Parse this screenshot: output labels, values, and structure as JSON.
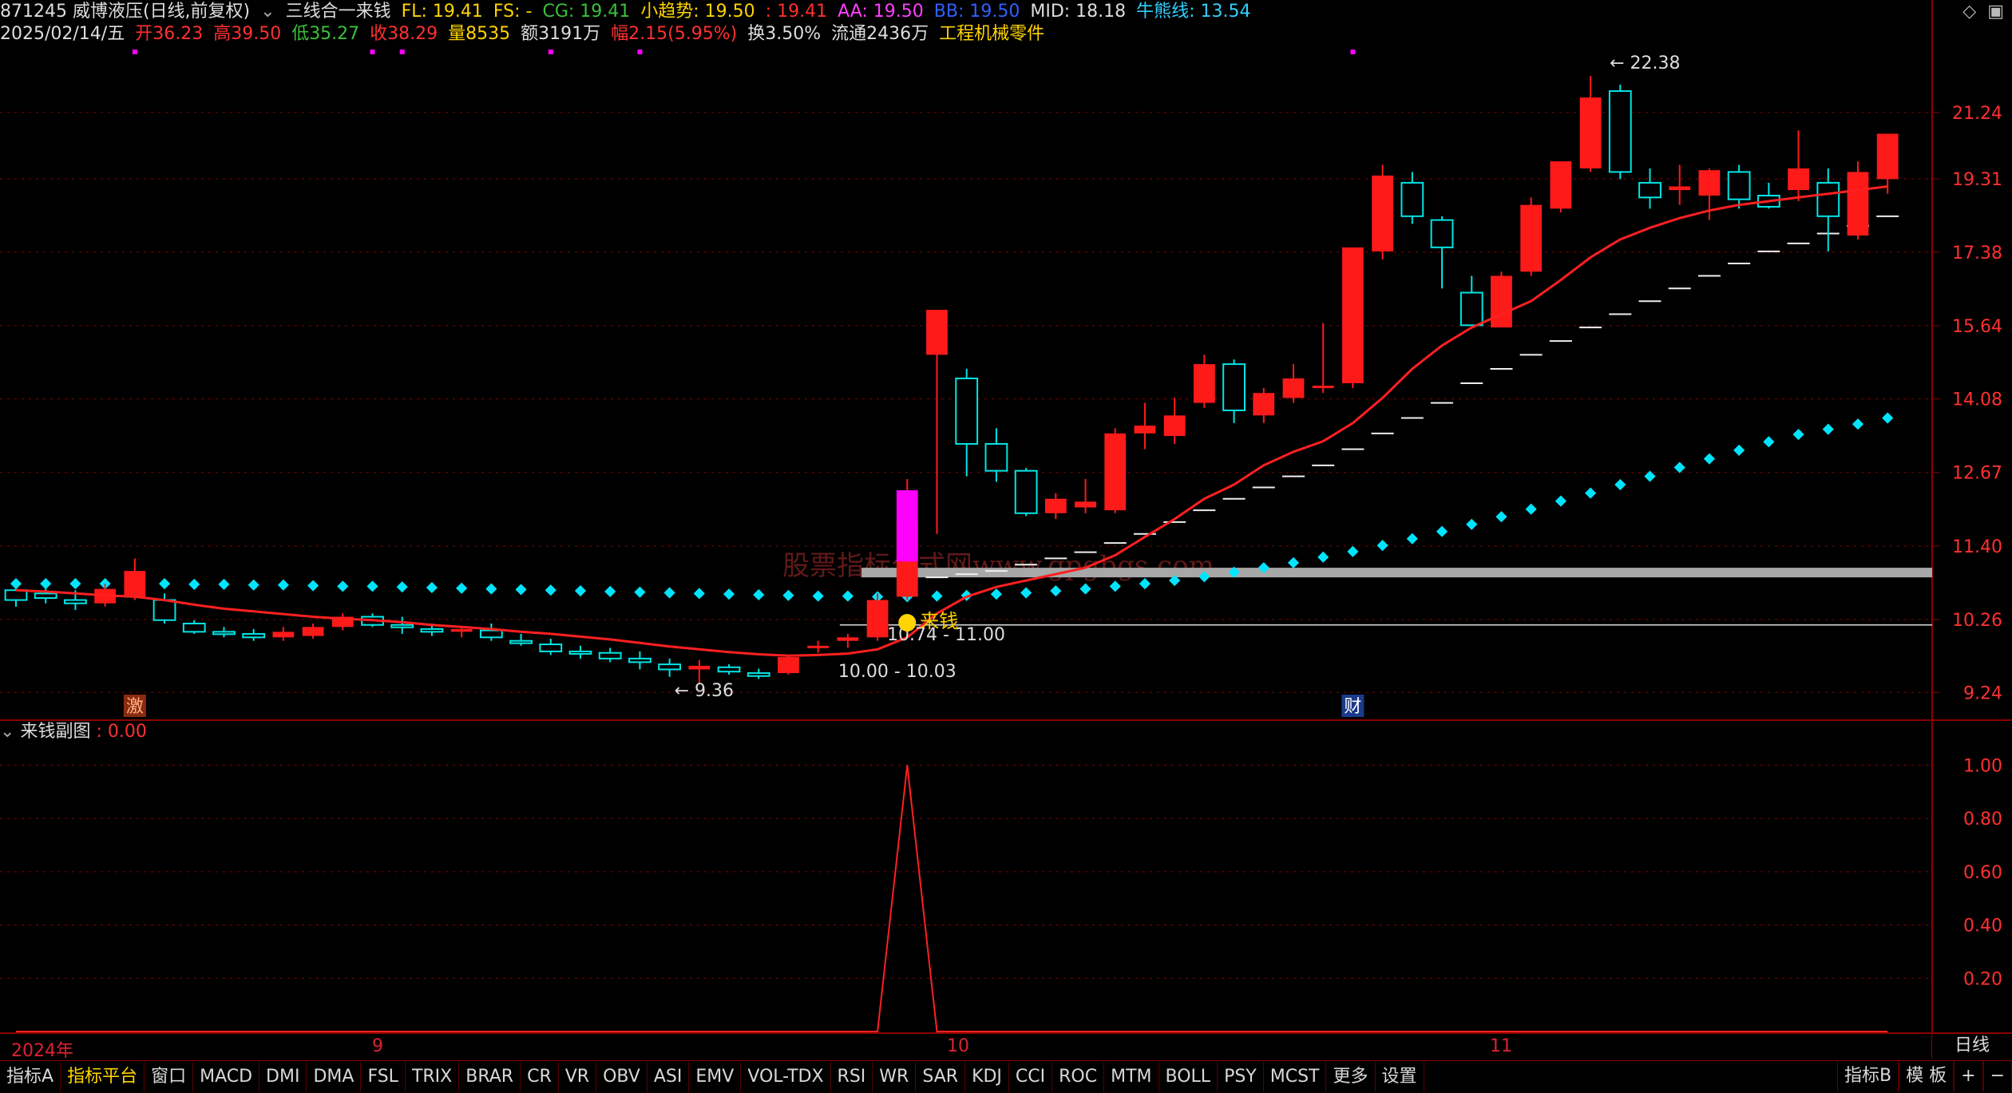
{
  "header": {
    "code_name": "871245 威博液压(日线,前复权)",
    "indicator_name": "三线合一来钱",
    "fl": "FL: 19.41",
    "fs": "FS: -",
    "cg": "CG: 19.41",
    "xqs": "小趋势: 19.50",
    "dash_val": ": 19.41",
    "aa": "AA: 19.50",
    "bb": "BB: 19.50",
    "mid": "MID: 18.18",
    "nxx": "牛熊线: 13.54",
    "date": "2025/02/14/五",
    "open": "开36.23",
    "high": "高39.50",
    "low": "低35.27",
    "close": "收38.29",
    "vol": "量8535",
    "amount": "额3191万",
    "change": "幅2.15(5.95%)",
    "turnover": "换3.50%",
    "float": "流通2436万",
    "industry": "工程机械零件"
  },
  "topright_icons": [
    "diamond-icon",
    "window-icon"
  ],
  "colors": {
    "up": "#ff1a1a",
    "down": "#00e5e5",
    "ma": "#ff2020",
    "dots": "#00e5ff",
    "grid": "#8b0000",
    "magenta": "#ff00ff",
    "gray_band": "#a8a8a8"
  },
  "main_axis": {
    "ticks": [
      "21.24",
      "19.31",
      "17.38",
      "15.64",
      "14.08",
      "12.67",
      "11.40",
      "10.26",
      "9.24"
    ]
  },
  "annotations": {
    "high_label": "22.38",
    "low_label": "9.36",
    "range1": "10.00 - 10.03",
    "range2": "10.74 - 11.00",
    "signal_label": "来钱",
    "signal_icon": "coin-icon",
    "mark_ji": "激",
    "mark_cai": "财",
    "watermark": "股票指标公式网www.gpgbgs.com"
  },
  "subchart": {
    "title": "来钱副图",
    "value": ": 0.00",
    "ticks": [
      "1.00",
      "0.80",
      "0.60",
      "0.40",
      "0.20"
    ]
  },
  "date_axis": {
    "labels": [
      "2024年",
      "9",
      "10",
      "11"
    ],
    "period_button": "日线"
  },
  "toolbar": {
    "tabs": [
      "指标A",
      "指标平台",
      "窗口",
      "MACD",
      "DMI",
      "DMA",
      "FSL",
      "TRIX",
      "BRAR",
      "CR",
      "VR",
      "OBV",
      "ASI",
      "EMV",
      "VOL-TDX",
      "RSI",
      "WR",
      "SAR",
      "KDJ",
      "CCI",
      "ROC",
      "MTM",
      "BOLL",
      "PSY",
      "MCST",
      "更多",
      "设置"
    ],
    "active_index": 1,
    "right": [
      "指标B",
      "模 板",
      "+",
      "−"
    ]
  },
  "chart_data": {
    "type": "candlestick",
    "y_scale": "log",
    "ylim": [
      8.9,
      23.3
    ],
    "candles": [
      {
        "o": 10.7,
        "h": 10.85,
        "l": 10.45,
        "c": 10.55
      },
      {
        "o": 10.65,
        "h": 10.8,
        "l": 10.5,
        "c": 10.58
      },
      {
        "o": 10.55,
        "h": 10.7,
        "l": 10.4,
        "c": 10.5
      },
      {
        "o": 10.5,
        "h": 10.8,
        "l": 10.45,
        "c": 10.72
      },
      {
        "o": 10.6,
        "h": 11.2,
        "l": 10.55,
        "c": 11.0
      },
      {
        "o": 10.55,
        "h": 10.65,
        "l": 10.2,
        "c": 10.25
      },
      {
        "o": 10.2,
        "h": 10.25,
        "l": 10.05,
        "c": 10.08
      },
      {
        "o": 10.08,
        "h": 10.15,
        "l": 10.0,
        "c": 10.05
      },
      {
        "o": 10.05,
        "h": 10.12,
        "l": 9.95,
        "c": 10.0
      },
      {
        "o": 10.0,
        "h": 10.15,
        "l": 9.95,
        "c": 10.08
      },
      {
        "o": 10.02,
        "h": 10.2,
        "l": 9.98,
        "c": 10.15
      },
      {
        "o": 10.15,
        "h": 10.35,
        "l": 10.1,
        "c": 10.3
      },
      {
        "o": 10.3,
        "h": 10.35,
        "l": 10.15,
        "c": 10.18
      },
      {
        "o": 10.18,
        "h": 10.3,
        "l": 10.05,
        "c": 10.15
      },
      {
        "o": 10.12,
        "h": 10.2,
        "l": 10.02,
        "c": 10.08
      },
      {
        "o": 10.08,
        "h": 10.15,
        "l": 10.0,
        "c": 10.12
      },
      {
        "o": 10.1,
        "h": 10.2,
        "l": 9.95,
        "c": 10.0
      },
      {
        "o": 9.95,
        "h": 10.05,
        "l": 9.88,
        "c": 9.92
      },
      {
        "o": 9.9,
        "h": 9.98,
        "l": 9.75,
        "c": 9.8
      },
      {
        "o": 9.8,
        "h": 9.88,
        "l": 9.7,
        "c": 9.78
      },
      {
        "o": 9.78,
        "h": 9.85,
        "l": 9.65,
        "c": 9.7
      },
      {
        "o": 9.7,
        "h": 9.8,
        "l": 9.55,
        "c": 9.65
      },
      {
        "o": 9.62,
        "h": 9.7,
        "l": 9.45,
        "c": 9.55
      },
      {
        "o": 9.55,
        "h": 9.68,
        "l": 9.36,
        "c": 9.6
      },
      {
        "o": 9.58,
        "h": 9.62,
        "l": 9.48,
        "c": 9.52
      },
      {
        "o": 9.5,
        "h": 9.56,
        "l": 9.42,
        "c": 9.46
      },
      {
        "o": 9.5,
        "h": 9.75,
        "l": 9.48,
        "c": 9.72
      },
      {
        "o": 9.85,
        "h": 9.95,
        "l": 9.78,
        "c": 9.88
      },
      {
        "o": 9.95,
        "h": 10.05,
        "l": 9.85,
        "c": 10.0
      },
      {
        "o": 10.0,
        "h": 10.65,
        "l": 9.95,
        "c": 10.55
      },
      {
        "o": 10.6,
        "h": 12.55,
        "l": 10.55,
        "c": 11.8
      },
      {
        "o": 15.0,
        "h": 15.1,
        "l": 11.6,
        "c": 16.0
      },
      {
        "o": 14.5,
        "h": 14.7,
        "l": 12.6,
        "c": 13.2
      },
      {
        "o": 13.2,
        "h": 13.5,
        "l": 12.5,
        "c": 12.7
      },
      {
        "o": 12.7,
        "h": 12.75,
        "l": 11.9,
        "c": 11.95
      },
      {
        "o": 11.95,
        "h": 12.3,
        "l": 11.85,
        "c": 12.2
      },
      {
        "o": 12.05,
        "h": 12.55,
        "l": 11.95,
        "c": 12.15
      },
      {
        "o": 12.0,
        "h": 13.5,
        "l": 11.95,
        "c": 13.4
      },
      {
        "o": 13.4,
        "h": 14.0,
        "l": 13.1,
        "c": 13.55
      },
      {
        "o": 13.35,
        "h": 14.1,
        "l": 13.2,
        "c": 13.75
      },
      {
        "o": 14.0,
        "h": 15.0,
        "l": 13.9,
        "c": 14.8
      },
      {
        "o": 14.8,
        "h": 14.9,
        "l": 13.6,
        "c": 13.85
      },
      {
        "o": 13.75,
        "h": 14.3,
        "l": 13.6,
        "c": 14.2
      },
      {
        "o": 14.1,
        "h": 14.8,
        "l": 14.0,
        "c": 14.5
      },
      {
        "o": 14.3,
        "h": 15.7,
        "l": 14.2,
        "c": 14.35
      },
      {
        "o": 14.4,
        "h": 17.3,
        "l": 14.3,
        "c": 17.5
      },
      {
        "o": 17.4,
        "h": 19.7,
        "l": 17.2,
        "c": 19.4
      },
      {
        "o": 19.2,
        "h": 19.5,
        "l": 18.1,
        "c": 18.3
      },
      {
        "o": 18.2,
        "h": 18.3,
        "l": 16.5,
        "c": 17.5
      },
      {
        "o": 16.4,
        "h": 16.8,
        "l": 16.2,
        "c": 15.65
      },
      {
        "o": 15.6,
        "h": 16.9,
        "l": 15.6,
        "c": 16.8
      },
      {
        "o": 16.9,
        "h": 18.8,
        "l": 16.8,
        "c": 18.6
      },
      {
        "o": 18.5,
        "h": 19.8,
        "l": 18.4,
        "c": 19.8
      },
      {
        "o": 19.6,
        "h": 22.38,
        "l": 19.5,
        "c": 21.7
      },
      {
        "o": 21.9,
        "h": 22.1,
        "l": 19.3,
        "c": 19.5
      },
      {
        "o": 19.2,
        "h": 19.6,
        "l": 18.5,
        "c": 18.8
      },
      {
        "o": 19.0,
        "h": 19.7,
        "l": 18.6,
        "c": 19.1
      },
      {
        "o": 18.85,
        "h": 19.6,
        "l": 18.2,
        "c": 19.55
      },
      {
        "o": 19.5,
        "h": 19.7,
        "l": 18.5,
        "c": 18.75
      },
      {
        "o": 18.85,
        "h": 19.2,
        "l": 18.5,
        "c": 18.55
      },
      {
        "o": 19.0,
        "h": 20.7,
        "l": 18.7,
        "c": 19.6
      },
      {
        "o": 19.2,
        "h": 19.6,
        "l": 17.4,
        "c": 18.3
      },
      {
        "o": 17.8,
        "h": 19.8,
        "l": 17.7,
        "c": 19.5
      },
      {
        "o": 19.3,
        "h": 20.6,
        "l": 18.9,
        "c": 20.6
      }
    ],
    "ma": [
      10.7,
      10.68,
      10.65,
      10.62,
      10.6,
      10.55,
      10.48,
      10.42,
      10.38,
      10.34,
      10.3,
      10.27,
      10.25,
      10.22,
      10.18,
      10.15,
      10.12,
      10.08,
      10.05,
      10.01,
      9.97,
      9.92,
      9.87,
      9.83,
      9.79,
      9.76,
      9.74,
      9.75,
      9.77,
      9.83,
      10.0,
      10.35,
      10.6,
      10.75,
      10.85,
      10.95,
      11.05,
      11.25,
      11.55,
      11.85,
      12.2,
      12.45,
      12.8,
      13.05,
      13.25,
      13.6,
      14.1,
      14.7,
      15.2,
      15.6,
      15.9,
      16.2,
      16.7,
      17.25,
      17.7,
      18.0,
      18.25,
      18.45,
      18.6,
      18.7,
      18.8,
      18.9,
      19.0,
      19.1
    ],
    "dots": [
      10.8,
      10.8,
      10.8,
      10.8,
      10.8,
      10.8,
      10.79,
      10.79,
      10.78,
      10.78,
      10.77,
      10.76,
      10.76,
      10.75,
      10.74,
      10.73,
      10.72,
      10.71,
      10.7,
      10.69,
      10.68,
      10.67,
      10.66,
      10.65,
      10.64,
      10.63,
      10.62,
      10.61,
      10.61,
      10.6,
      10.6,
      10.61,
      10.62,
      10.64,
      10.66,
      10.69,
      10.72,
      10.76,
      10.8,
      10.85,
      10.91,
      10.98,
      11.05,
      11.13,
      11.22,
      11.31,
      11.41,
      11.52,
      11.64,
      11.76,
      11.89,
      12.02,
      12.16,
      12.3,
      12.45,
      12.6,
      12.76,
      12.92,
      13.08,
      13.24,
      13.38,
      13.48,
      13.58,
      13.7
    ],
    "steps": [
      {
        "i": 31,
        "v": 10.9
      },
      {
        "i": 32,
        "v": 10.95
      },
      {
        "i": 33,
        "v": 11.0
      },
      {
        "i": 34,
        "v": 11.1
      },
      {
        "i": 35,
        "v": 11.2
      },
      {
        "i": 36,
        "v": 11.3
      },
      {
        "i": 37,
        "v": 11.45
      },
      {
        "i": 38,
        "v": 11.6
      },
      {
        "i": 39,
        "v": 11.8
      },
      {
        "i": 40,
        "v": 12.0
      },
      {
        "i": 41,
        "v": 12.2
      },
      {
        "i": 42,
        "v": 12.4
      },
      {
        "i": 43,
        "v": 12.6
      },
      {
        "i": 44,
        "v": 12.8
      },
      {
        "i": 45,
        "v": 13.1
      },
      {
        "i": 46,
        "v": 13.4
      },
      {
        "i": 47,
        "v": 13.7
      },
      {
        "i": 48,
        "v": 14.0
      },
      {
        "i": 49,
        "v": 14.4
      },
      {
        "i": 50,
        "v": 14.7
      },
      {
        "i": 51,
        "v": 15.0
      },
      {
        "i": 52,
        "v": 15.3
      },
      {
        "i": 53,
        "v": 15.6
      },
      {
        "i": 54,
        "v": 15.9
      },
      {
        "i": 55,
        "v": 16.2
      },
      {
        "i": 56,
        "v": 16.5
      },
      {
        "i": 57,
        "v": 16.8
      },
      {
        "i": 58,
        "v": 17.1
      },
      {
        "i": 59,
        "v": 17.4
      },
      {
        "i": 60,
        "v": 17.6
      },
      {
        "i": 61,
        "v": 17.85
      },
      {
        "i": 62,
        "v": 18.05
      },
      {
        "i": 63,
        "v": 18.3
      }
    ],
    "sub_series": [
      0,
      0,
      0,
      0,
      0,
      0,
      0,
      0,
      0,
      0,
      0,
      0,
      0,
      0,
      0,
      0,
      0,
      0,
      0,
      0,
      0,
      0,
      0,
      0,
      0,
      0,
      0,
      0,
      0,
      0,
      1,
      0,
      0,
      0,
      0,
      0,
      0,
      0,
      0,
      0,
      0,
      0,
      0,
      0,
      0,
      0,
      0,
      0,
      0,
      0,
      0,
      0,
      0,
      0,
      0,
      0,
      0,
      0,
      0,
      0,
      0,
      0,
      0,
      0
    ],
    "sub_ylim": [
      0,
      1.1
    ]
  }
}
